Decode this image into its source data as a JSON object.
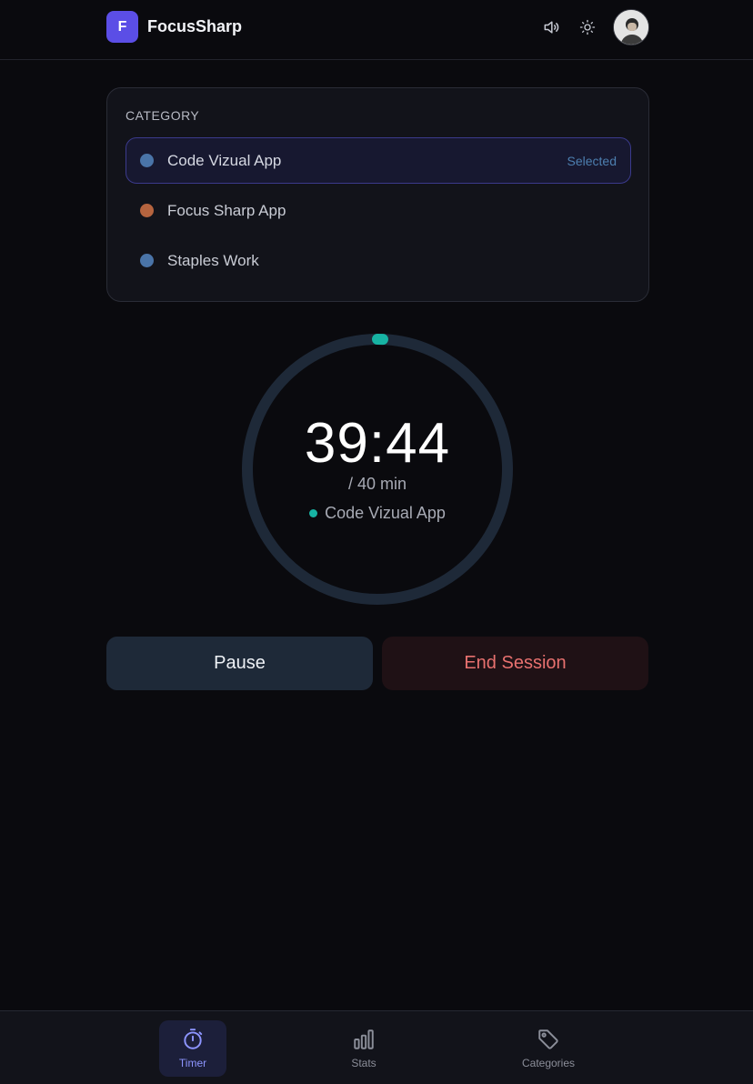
{
  "brand": {
    "logo_letter": "F",
    "name": "FocusSharp",
    "accent_color": "#5b4ee6"
  },
  "header": {
    "icons": [
      "speaker-icon",
      "sun-icon"
    ],
    "avatar": "user-avatar"
  },
  "category": {
    "title": "CATEGORY",
    "items": [
      {
        "label": "Code Vizual App",
        "color": "#4a74a8",
        "selected": true,
        "badge": "Selected"
      },
      {
        "label": "Focus Sharp App",
        "color": "#b5643f",
        "selected": false
      },
      {
        "label": "Staples Work",
        "color": "#4a74a8",
        "selected": false
      }
    ]
  },
  "timer": {
    "time": "39:44",
    "total": "/ 40 min",
    "category": "Code Vizual App",
    "category_color": "#17b3a3",
    "progress_elapsed_fraction": 0.0067
  },
  "actions": {
    "pause_label": "Pause",
    "end_label": "End Session"
  },
  "nav": {
    "items": [
      {
        "label": "Timer",
        "icon": "stopwatch-icon",
        "active": true
      },
      {
        "label": "Stats",
        "icon": "bar-chart-icon",
        "active": false
      },
      {
        "label": "Categories",
        "icon": "tag-icon",
        "active": false
      }
    ]
  }
}
